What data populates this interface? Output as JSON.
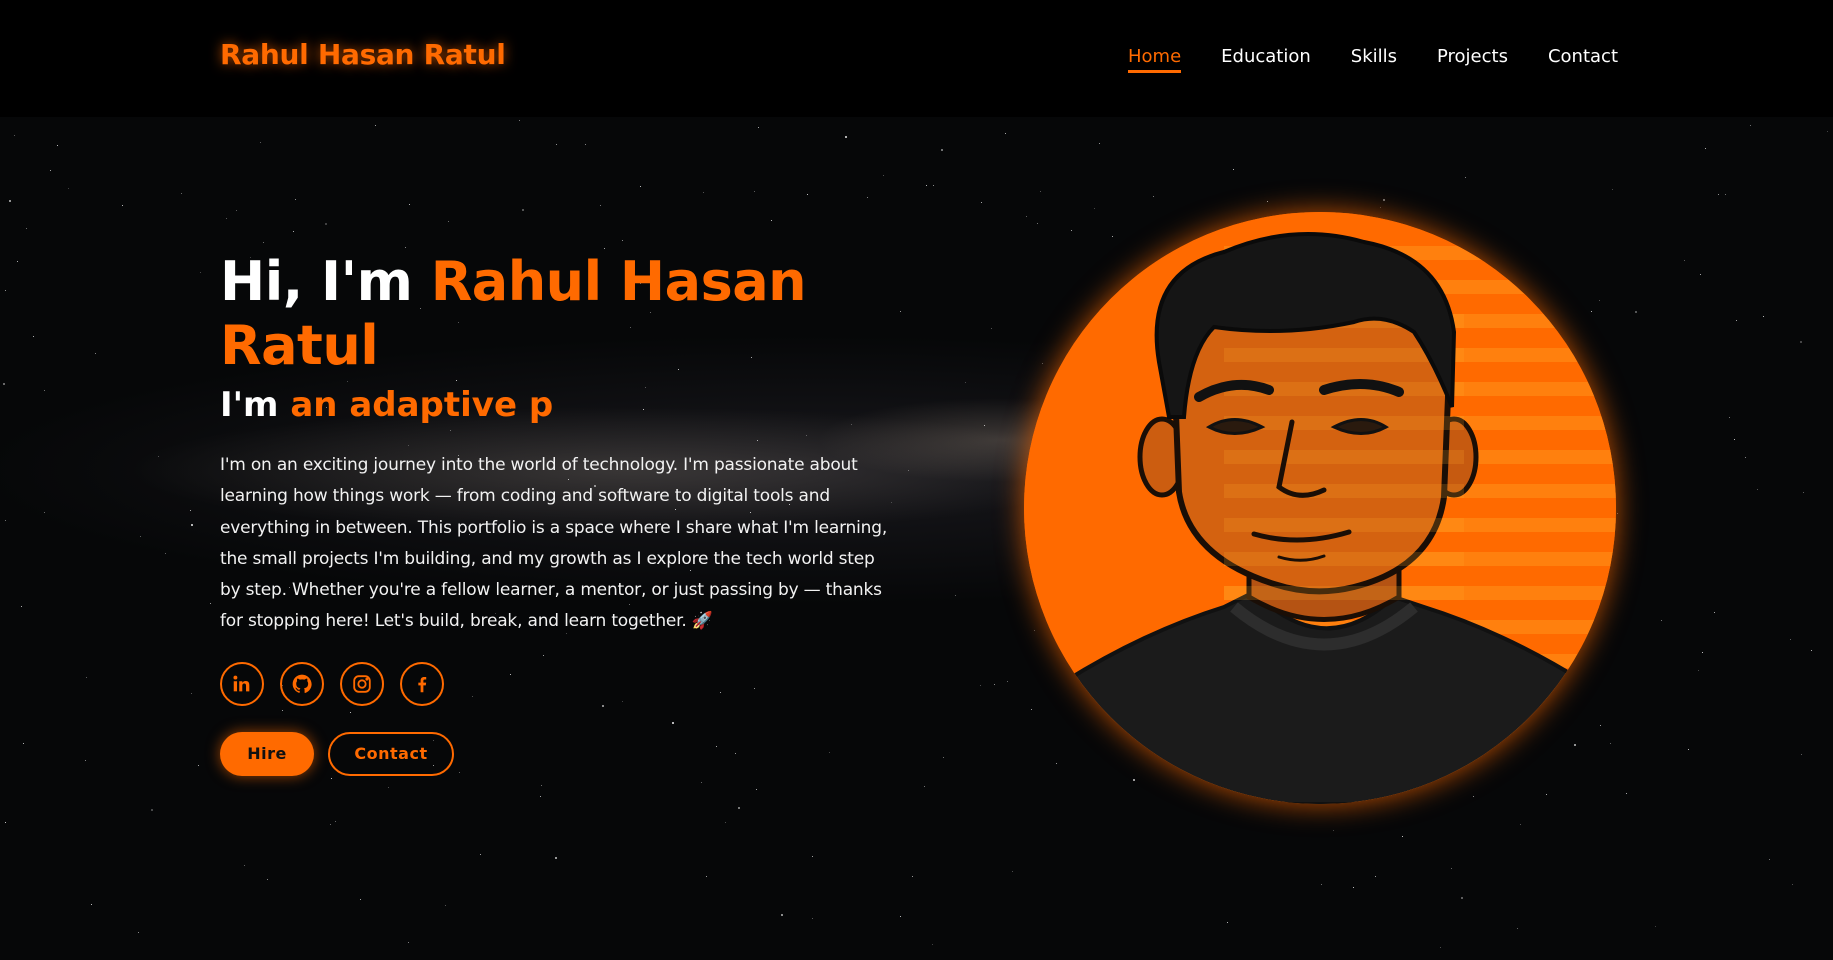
{
  "brand": {
    "name": "Rahul Hasan Ratul"
  },
  "nav": {
    "items": [
      {
        "label": "Home",
        "active": true
      },
      {
        "label": "Education",
        "active": false
      },
      {
        "label": "Skills",
        "active": false
      },
      {
        "label": "Projects",
        "active": false
      },
      {
        "label": "Contact",
        "active": false
      }
    ]
  },
  "hero": {
    "greeting": "Hi, I'm ",
    "name": "Rahul Hasan Ratul",
    "role_prefix": "I'm ",
    "role_typed": "an adaptive p",
    "description": "I'm on an exciting journey into the world of technology. I'm passionate about learning how things work — from coding and software to digital tools and everything in between. This portfolio is a space where I share what I'm learning, the small projects I'm building, and my growth as I explore the tech world step by step. Whether you're a fellow learner, a mentor, or just passing by — thanks for stopping here! Let's build, break, and learn together. 🚀",
    "socials": [
      {
        "icon": "linkedin-icon"
      },
      {
        "icon": "github-icon"
      },
      {
        "icon": "instagram-icon"
      },
      {
        "icon": "facebook-icon"
      }
    ],
    "hire_label": "Hire",
    "contact_label": "Contact"
  },
  "colors": {
    "accent": "#ff6a00",
    "background": "#060708"
  }
}
